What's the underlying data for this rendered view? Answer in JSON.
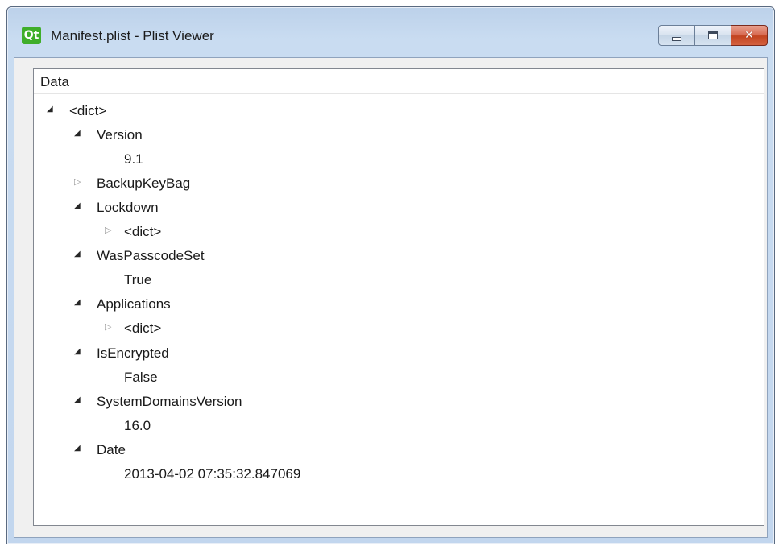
{
  "window": {
    "title": "Manifest.plist - Plist Viewer",
    "logo_text": "Qt",
    "minimize_label": "",
    "maximize_label": "",
    "close_label": "✕"
  },
  "tree": {
    "column_header": "Data",
    "rows": [
      {
        "label": "<dict>",
        "level": 0,
        "state": "expanded"
      },
      {
        "label": "Version",
        "level": 1,
        "state": "expanded"
      },
      {
        "label": "9.1",
        "level": 2,
        "state": "leaf"
      },
      {
        "label": "BackupKeyBag",
        "level": 1,
        "state": "collapsed"
      },
      {
        "label": "Lockdown",
        "level": 1,
        "state": "expanded"
      },
      {
        "label": "<dict>",
        "level": 2,
        "state": "collapsed"
      },
      {
        "label": "WasPasscodeSet",
        "level": 1,
        "state": "expanded"
      },
      {
        "label": "True",
        "level": 2,
        "state": "leaf"
      },
      {
        "label": "Applications",
        "level": 1,
        "state": "expanded"
      },
      {
        "label": "<dict>",
        "level": 2,
        "state": "collapsed"
      },
      {
        "label": "IsEncrypted",
        "level": 1,
        "state": "expanded"
      },
      {
        "label": "False",
        "level": 2,
        "state": "leaf"
      },
      {
        "label": "SystemDomainsVersion",
        "level": 1,
        "state": "expanded"
      },
      {
        "label": "16.0",
        "level": 2,
        "state": "leaf"
      },
      {
        "label": "Date",
        "level": 1,
        "state": "expanded"
      },
      {
        "label": "2013-04-02 07:35:32.847069",
        "level": 2,
        "state": "leaf"
      }
    ]
  }
}
